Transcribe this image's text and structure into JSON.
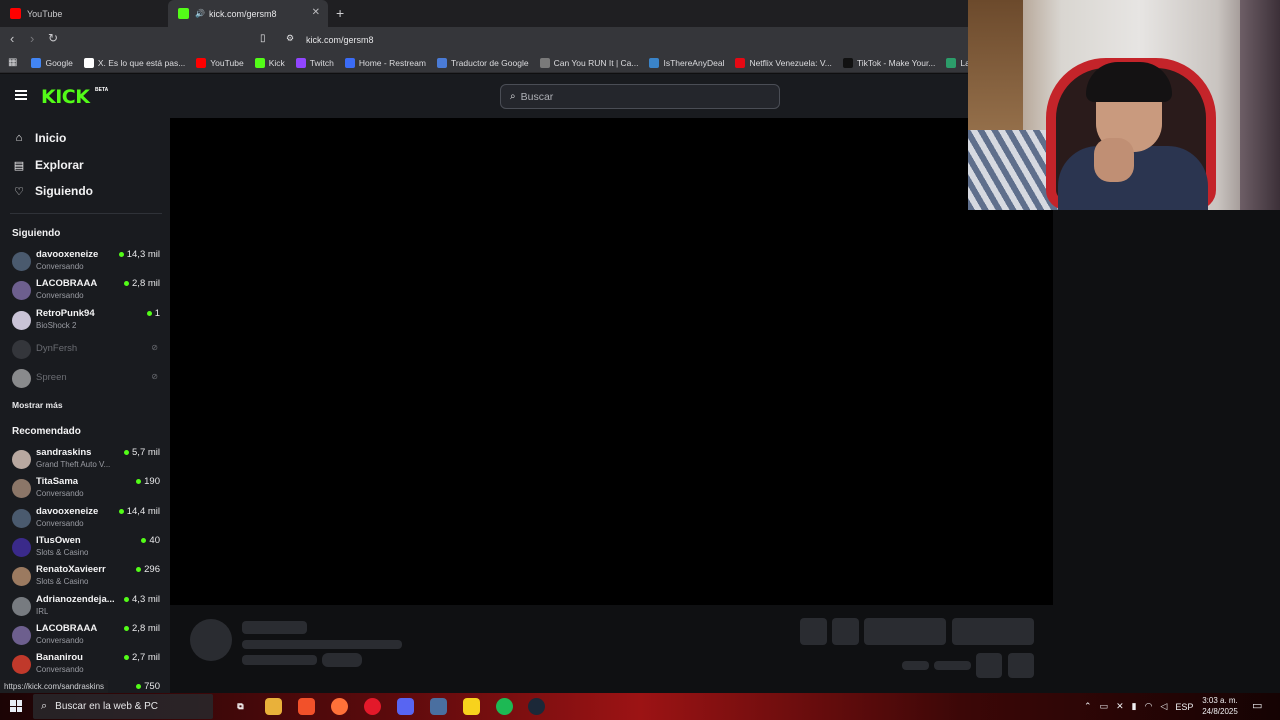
{
  "browser": {
    "tabs": [
      {
        "label": "YouTube",
        "favicon_color": "#ff0000"
      },
      {
        "label": "kick.com/gersm8",
        "favicon_color": "#53fc18",
        "active": true
      }
    ],
    "url": "kick.com/gersm8",
    "new_tab": "+",
    "bookmarks": [
      {
        "label": "Google",
        "color": "#4285f4"
      },
      {
        "label": "X. Es lo que está pas...",
        "color": "#ffffff"
      },
      {
        "label": "YouTube",
        "color": "#ff0000"
      },
      {
        "label": "Kick",
        "color": "#53fc18"
      },
      {
        "label": "Twitch",
        "color": "#9146ff"
      },
      {
        "label": "Home - Restream",
        "color": "#3b6cf6"
      },
      {
        "label": "Traductor de Google",
        "color": "#4a7bd6"
      },
      {
        "label": "Can You RUN It | Ca...",
        "color": "#7a7a7a"
      },
      {
        "label": "IsThereAnyDeal",
        "color": "#3a84c9"
      },
      {
        "label": "Netflix Venezuela: V...",
        "color": "#e50914"
      },
      {
        "label": "TikTok - Make Your...",
        "color": "#111111"
      },
      {
        "label": "Las compara",
        "color": "#2c9d6a"
      }
    ]
  },
  "kick": {
    "logo": "KICK",
    "beta": "BETA",
    "search_placeholder": "Buscar",
    "nav": [
      {
        "label": "Inicio",
        "icon": "home-icon"
      },
      {
        "label": "Explorar",
        "icon": "explore-icon"
      },
      {
        "label": "Siguiendo",
        "icon": "heart-icon"
      }
    ],
    "following_title": "Siguiendo",
    "following": [
      {
        "name": "davooxeneize",
        "category": "Conversando",
        "viewers": "14,3 mil",
        "live": true,
        "avatar_color": "#4a5a6e"
      },
      {
        "name": "LACOBRAAA",
        "category": "Conversando",
        "viewers": "2,8 mil",
        "live": true,
        "avatar_color": "#6d5f8e"
      },
      {
        "name": "RetroPunk94",
        "category": "BioShock 2",
        "viewers": "1",
        "live": true,
        "avatar_color": "#c9c3d6"
      },
      {
        "name": "DynFersh",
        "category": "",
        "viewers": "",
        "live": false,
        "avatar_color": "#4a4c52"
      },
      {
        "name": "Spreen",
        "category": "",
        "viewers": "",
        "live": false,
        "avatar_color": "#e6e6e6"
      }
    ],
    "show_more": "Mostrar más",
    "recommended_title": "Recomendado",
    "recommended": [
      {
        "name": "sandraskins",
        "category": "Grand Theft Auto V...",
        "viewers": "5,7 mil",
        "avatar_color": "#b8a8a0"
      },
      {
        "name": "TitaSama",
        "category": "Conversando",
        "viewers": "190",
        "avatar_color": "#8b7668"
      },
      {
        "name": "davooxeneize",
        "category": "Conversando",
        "viewers": "14,4 mil",
        "avatar_color": "#4a5a6e"
      },
      {
        "name": "ITusOwen",
        "category": "Slots & Casino",
        "viewers": "40",
        "avatar_color": "#3a2a8a"
      },
      {
        "name": "RenatoXavieerr",
        "category": "Slots & Casino",
        "viewers": "296",
        "avatar_color": "#9b7a60"
      },
      {
        "name": "Adrianozendeja...",
        "category": "IRL",
        "viewers": "4,3 mil",
        "avatar_color": "#777b80"
      },
      {
        "name": "LACOBRAAA",
        "category": "Conversando",
        "viewers": "2,8 mil",
        "avatar_color": "#6d5f8e"
      },
      {
        "name": "Bananirou",
        "category": "Conversando",
        "viewers": "2,7 mil",
        "avatar_color": "#c0392b"
      },
      {
        "name": "",
        "category": "",
        "viewers": "750",
        "avatar_color": "#555"
      }
    ],
    "status_url": "https://kick.com/sandraskins"
  },
  "taskbar": {
    "search_placeholder": "Buscar en la web & PC",
    "language": "ESP",
    "time": "3:03 a. m.",
    "date": "24/8/2025",
    "apps": [
      {
        "name": "task-view",
        "color": "transparent"
      },
      {
        "name": "file-explorer",
        "color": "#e9b13a"
      },
      {
        "name": "brave",
        "color": "#f2512a"
      },
      {
        "name": "firefox",
        "color": "#ff7139"
      },
      {
        "name": "opera",
        "color": "#e3192a"
      },
      {
        "name": "discord",
        "color": "#5865f2"
      },
      {
        "name": "calculator",
        "color": "#4a6fa0"
      },
      {
        "name": "sticky-notes",
        "color": "#f7d21d"
      },
      {
        "name": "spotify",
        "color": "#1db954"
      },
      {
        "name": "steam-like",
        "color": "#1b2838"
      }
    ]
  },
  "colors": {
    "kick_green": "#53fc18",
    "live_dot": "#53fc18"
  }
}
